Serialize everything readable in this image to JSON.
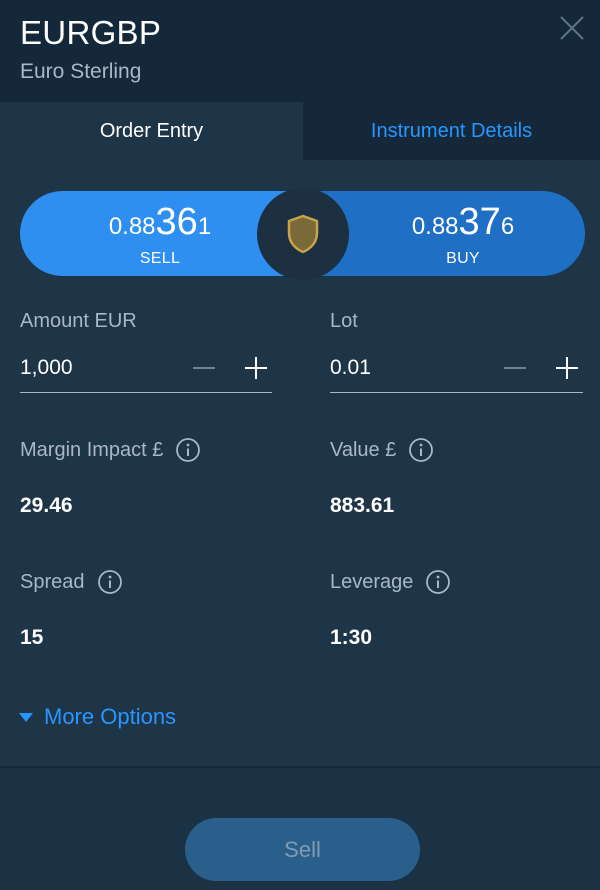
{
  "header": {
    "symbol": "EURGBP",
    "subtitle": "Euro Sterling"
  },
  "tabs": [
    {
      "label": "Order Entry",
      "active": true
    },
    {
      "label": "Instrument Details",
      "active": false
    }
  ],
  "quote": {
    "sell": {
      "prefix": "0.88",
      "big": "36",
      "suffix": "1",
      "label": "SELL"
    },
    "buy": {
      "prefix": "0.88",
      "big": "37",
      "suffix": "6",
      "label": "BUY"
    }
  },
  "amount": {
    "label": "Amount EUR",
    "value": "1,000"
  },
  "lot": {
    "label": "Lot",
    "value": "0.01"
  },
  "stats": {
    "margin_impact": {
      "label": "Margin Impact £",
      "value": "29.46"
    },
    "value": {
      "label": "Value £",
      "value": "883.61"
    },
    "spread": {
      "label": "Spread",
      "value": "15"
    },
    "leverage": {
      "label": "Leverage",
      "value": "1:30"
    }
  },
  "more_options": {
    "label": "More Options"
  },
  "action": {
    "label": "Sell"
  },
  "icons": {
    "close": "close-icon",
    "shield": "shield-icon",
    "info": "info-icon",
    "minus": "minus-icon",
    "plus": "plus-icon",
    "caret": "caret-down-icon"
  },
  "colors": {
    "accent": "#2996ff",
    "sell": "#2f8ff0",
    "buy": "#1f6fc4",
    "shield_gold": "#c9a34a"
  }
}
